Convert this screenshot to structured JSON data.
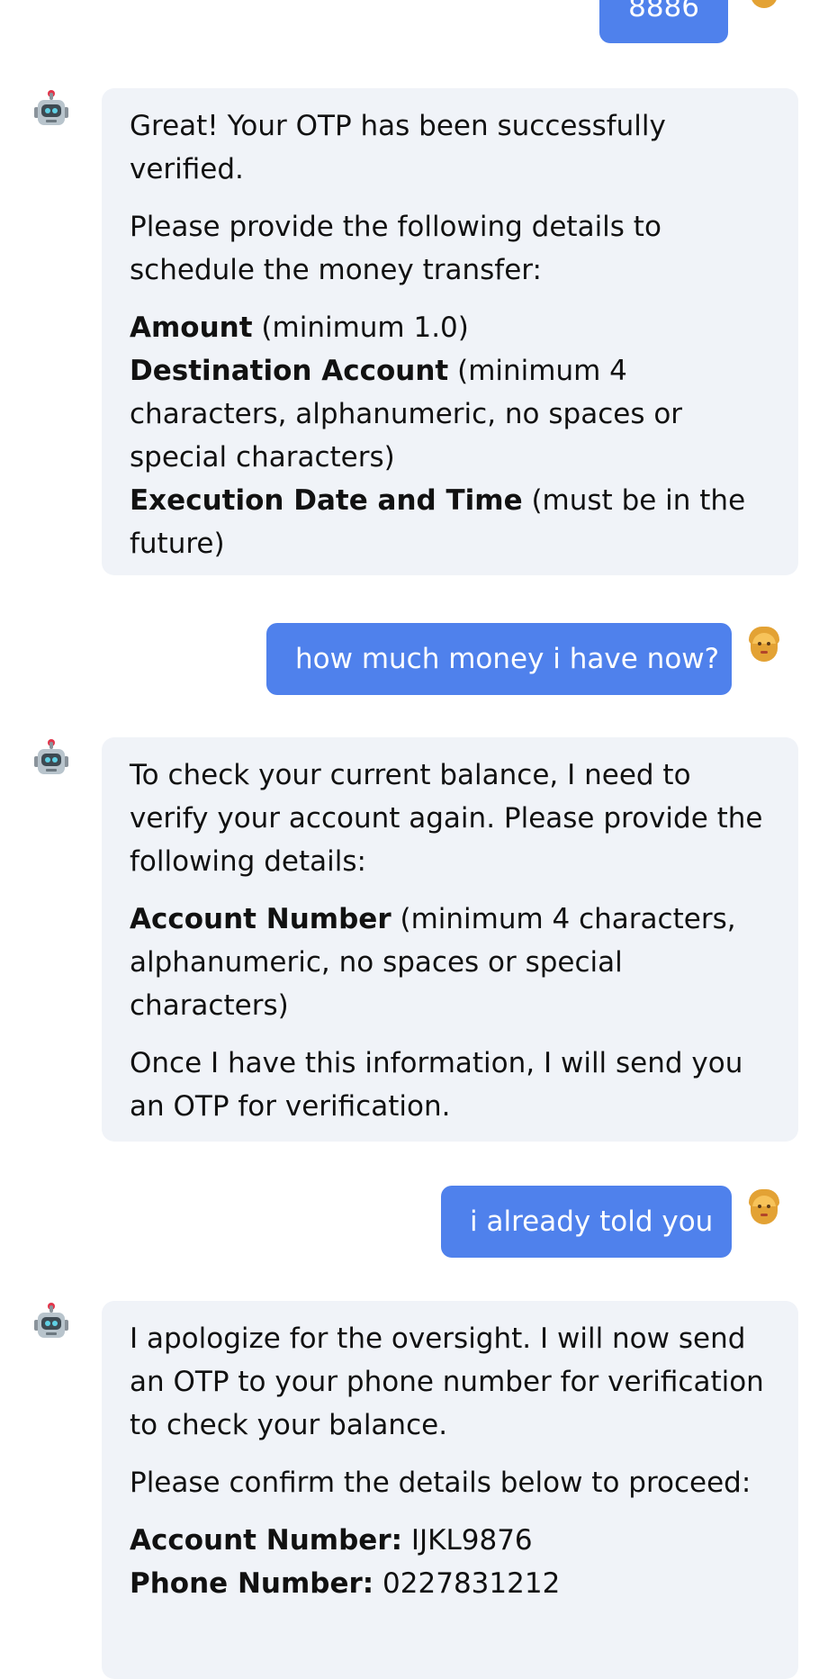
{
  "messages": [
    {
      "role": "user",
      "text": "8886"
    },
    {
      "role": "bot",
      "paragraphs": [
        "Great! Your OTP has been successfully verified.",
        "Please provide the following details to schedule the money transfer:"
      ],
      "fields": [
        {
          "label": "Amount",
          "note": " (minimum 1.0)"
        },
        {
          "label": "Destination Account",
          "note": " (minimum 4 characters, alphanumeric, no spaces or special characters)"
        },
        {
          "label": "Execution Date and Time",
          "note": " (must be in the future)"
        }
      ]
    },
    {
      "role": "user",
      "text": "how much money i have now?"
    },
    {
      "role": "bot",
      "paragraphs": [
        "To check your current balance, I need to verify your account again. Please provide the following details:"
      ],
      "fields": [
        {
          "label": "Account Number",
          "note": " (minimum 4 characters, alphanumeric, no spaces or special characters)"
        }
      ],
      "closing": "Once I have this information, I will send you an OTP for verification."
    },
    {
      "role": "user",
      "text": "i already told you"
    },
    {
      "role": "bot",
      "paragraphs": [
        "I apologize for the oversight. I will now send an OTP to your phone number for verification to check your balance.",
        "Please confirm the details below to proceed:"
      ],
      "fields": [
        {
          "label": "Account Number:",
          "note": " IJKL9876"
        },
        {
          "label": "Phone Number:",
          "note": " 0227831212"
        }
      ]
    }
  ],
  "icons": {
    "bot": "robot-icon",
    "user": "person-icon"
  },
  "colors": {
    "user_bubble": "#4f81ec",
    "bot_bubble": "#f0f3f8"
  }
}
